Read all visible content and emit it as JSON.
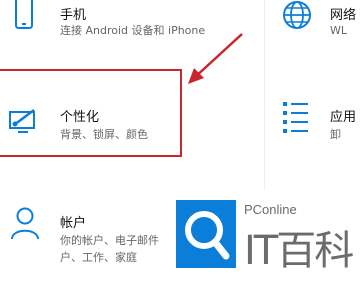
{
  "settings": {
    "phone": {
      "title": "手机",
      "desc": "连接 Android 设备和 iPhone"
    },
    "network": {
      "title": "网络",
      "desc": "WL"
    },
    "personalization": {
      "title": "个性化",
      "desc": "背景、锁屏、颜色"
    },
    "apps": {
      "title": "应用",
      "desc": "卸"
    },
    "accounts": {
      "title": "帐户",
      "desc_line1": "你的帐户、电子邮件",
      "desc_line2": "户、工作、家庭"
    }
  },
  "watermark": {
    "brand": "PConline",
    "title": "IT百科"
  },
  "colors": {
    "accent": "#0a7ed8",
    "highlight": "#c9252c"
  }
}
